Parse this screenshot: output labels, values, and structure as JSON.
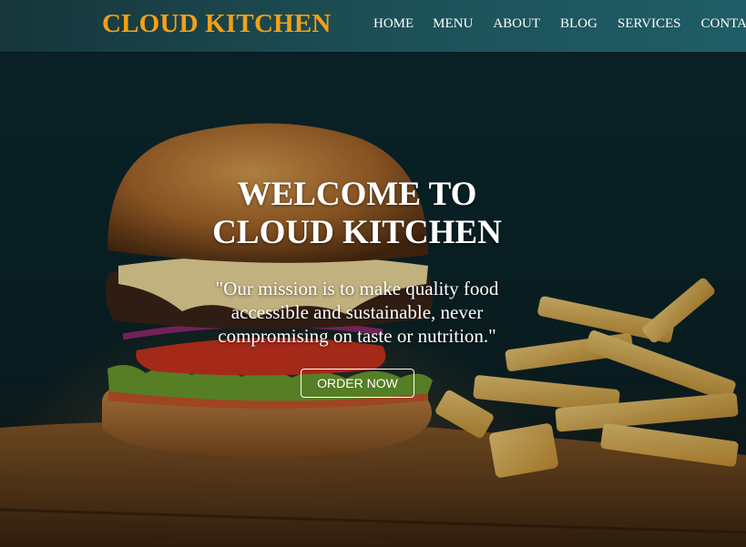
{
  "brand": {
    "name": "CLOUD KITCHEN",
    "color": "#f2a115"
  },
  "nav": {
    "items": [
      {
        "label": "HOME"
      },
      {
        "label": "MENU"
      },
      {
        "label": "ABOUT"
      },
      {
        "label": "BLOG"
      },
      {
        "label": "SERVICES"
      },
      {
        "label": "CONTACT"
      }
    ]
  },
  "hero": {
    "title_line1": "WELCOME TO",
    "title_line2": "CLOUD KITCHEN",
    "quote_line1": "\"Our mission is to make quality food",
    "quote_line2": "accessible and sustainable, never",
    "quote_line3": "compromising on taste or nutrition.\"",
    "cta_label": "ORDER NOW",
    "background_image": "burger-and-fries-photo"
  },
  "colors": {
    "navbar": "#1d5158",
    "text": "#ffffff"
  }
}
